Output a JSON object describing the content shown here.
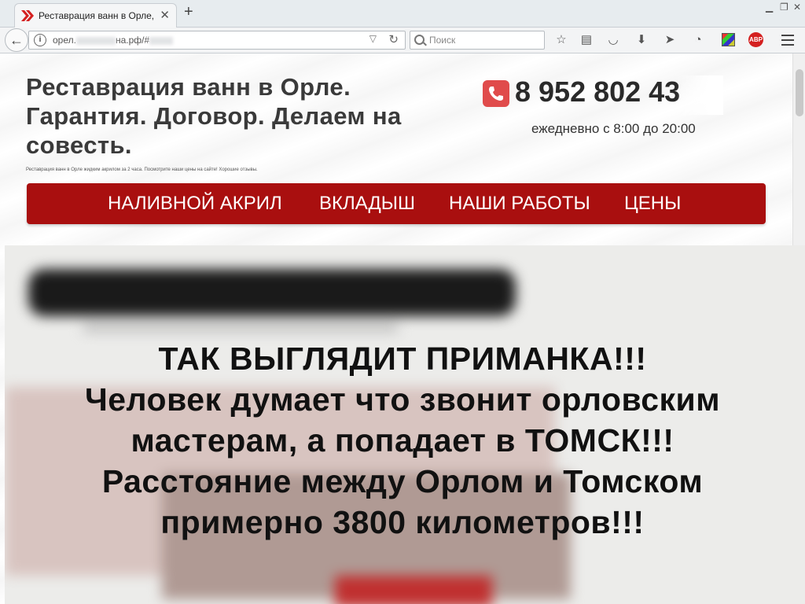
{
  "browser": {
    "tab_title": "Реставрация ванн в Орле, …",
    "url_visible": "орел.",
    "url_suffix": "на.рф/#",
    "search_placeholder": "Поиск",
    "extension_abp": "ABP"
  },
  "site": {
    "title": "Реставрация ванн в Орле. Гарантия. Договор. Делаем на совесть.",
    "tagline": "Реставрация ванн в Орле жидким акрилом за 2 часа. Посмотрите наши цены на сайте! Хорошие отзывы.",
    "phone": "8 952 802 43",
    "hours": "ежедневно с 8:00 до 20:00",
    "menu": [
      {
        "label": "НАЛИВНОЙ АКРИЛ"
      },
      {
        "label": "ВКЛАДЫШ"
      },
      {
        "label": "НАШИ РАБОТЫ"
      },
      {
        "label": "ЦЕНЫ"
      }
    ],
    "accent_color": "#a90f0f"
  },
  "overlay": {
    "lines": [
      "ТАК ВЫГЛЯДИТ ПРИМАНКА!!!",
      "Человек думает что звонит орловским",
      "мастерам, а попадает в ТОМСК!!!",
      "Расстояние между Орлом и Томском",
      "примерно 3800 километров!!!"
    ]
  }
}
